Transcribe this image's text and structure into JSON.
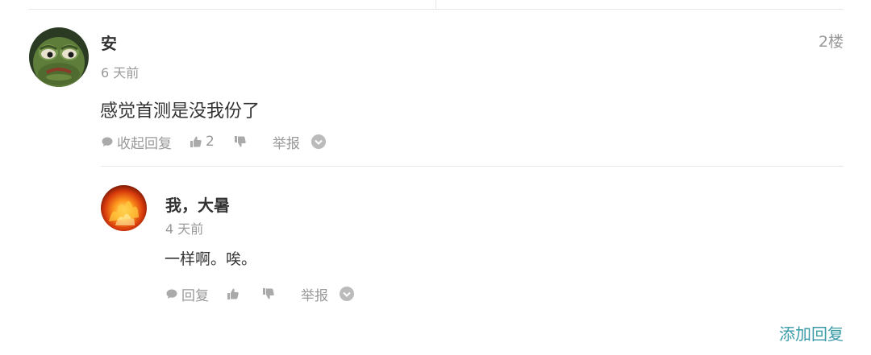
{
  "comment": {
    "username": "安",
    "floor": "2楼",
    "time": "6 天前",
    "text": "感觉首测是没我份了",
    "actions": {
      "reply_label": "收起回复",
      "like_count": "2",
      "report_label": "举报"
    },
    "icons": [
      "speech-bubble-icon",
      "thumbs-up-icon",
      "thumbs-down-icon",
      "chevron-down-circle-icon"
    ]
  },
  "reply": {
    "username": "我，大暑",
    "time": "4 天前",
    "text": "一样啊。唉。",
    "actions": {
      "reply_label": "回复",
      "report_label": "举报"
    }
  },
  "footer": {
    "add_reply_label": "添加回复"
  },
  "colors": {
    "text": "#333333",
    "muted": "#999999",
    "link": "#3a9ba8",
    "divider": "#e6e6e6"
  }
}
